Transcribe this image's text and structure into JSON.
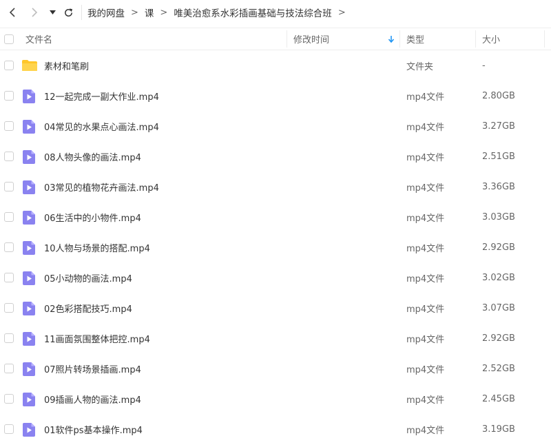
{
  "nav": {
    "breadcrumbs": [
      "我的网盘",
      "课",
      "唯美治愈系水彩插画基础与技法综合班"
    ],
    "separator": ">"
  },
  "header": {
    "name": "文件名",
    "modified": "修改时间",
    "type": "类型",
    "size": "大小"
  },
  "sort": {
    "column": "modified",
    "direction": "descending",
    "indicator_color": "#2196f3"
  },
  "colors": {
    "folder": "#ffc72b",
    "video_icon": "#8a82f0"
  },
  "files": [
    {
      "name": "素材和笔刷",
      "type": "文件夹",
      "size": "-",
      "icon": "folder-icon"
    },
    {
      "name": "12一起完成一副大作业.mp4",
      "type": "mp4文件",
      "size": "2.80GB",
      "icon": "video-file-icon"
    },
    {
      "name": "04常见的水果点心画法.mp4",
      "type": "mp4文件",
      "size": "3.27GB",
      "icon": "video-file-icon"
    },
    {
      "name": "08人物头像的画法.mp4",
      "type": "mp4文件",
      "size": "2.51GB",
      "icon": "video-file-icon"
    },
    {
      "name": "03常见的植物花卉画法.mp4",
      "type": "mp4文件",
      "size": "3.36GB",
      "icon": "video-file-icon"
    },
    {
      "name": "06生活中的小物件.mp4",
      "type": "mp4文件",
      "size": "3.03GB",
      "icon": "video-file-icon"
    },
    {
      "name": "10人物与场景的搭配.mp4",
      "type": "mp4文件",
      "size": "2.92GB",
      "icon": "video-file-icon"
    },
    {
      "name": "05小动物的画法.mp4",
      "type": "mp4文件",
      "size": "3.02GB",
      "icon": "video-file-icon"
    },
    {
      "name": "02色彩搭配技巧.mp4",
      "type": "mp4文件",
      "size": "3.07GB",
      "icon": "video-file-icon"
    },
    {
      "name": "11画面氛围整体把控.mp4",
      "type": "mp4文件",
      "size": "2.92GB",
      "icon": "video-file-icon"
    },
    {
      "name": "07照片转场景插画.mp4",
      "type": "mp4文件",
      "size": "2.52GB",
      "icon": "video-file-icon"
    },
    {
      "name": "09插画人物的画法.mp4",
      "type": "mp4文件",
      "size": "2.45GB",
      "icon": "video-file-icon"
    },
    {
      "name": "01软件ps基本操作.mp4",
      "type": "mp4文件",
      "size": "3.19GB",
      "icon": "video-file-icon"
    }
  ]
}
